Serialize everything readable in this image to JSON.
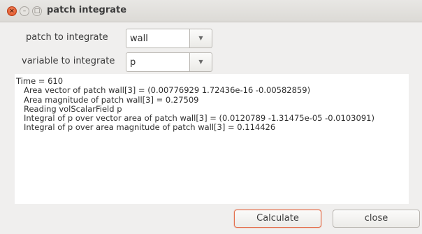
{
  "window": {
    "title": "patch integrate",
    "buttons": {
      "close_icon": "×",
      "minimize_icon": "–",
      "maximize_icon": "□"
    }
  },
  "form": {
    "patch_label": "patch to integrate",
    "patch_value": "wall",
    "variable_label": "variable to integrate",
    "variable_value": "p",
    "dropdown_icon": "▼"
  },
  "output": {
    "lines": [
      "Time = 610",
      "Area vector of patch wall[3] = (0.00776929 1.72436e-16 -0.00582859)",
      "Area magnitude of patch wall[3] = 0.27509",
      "Reading volScalarField p",
      "Integral of p over vector area of patch wall[3] = (0.0120789 -1.31475e-05 -0.0103091)",
      "Integral of p over area magnitude of patch wall[3] = 0.114426"
    ]
  },
  "actions": {
    "calculate_label": "Calculate",
    "close_label": "close"
  },
  "colors": {
    "accent": "#e36d4a",
    "window_bg": "#f0efee",
    "titlebar_bg": "#dcdad6"
  }
}
